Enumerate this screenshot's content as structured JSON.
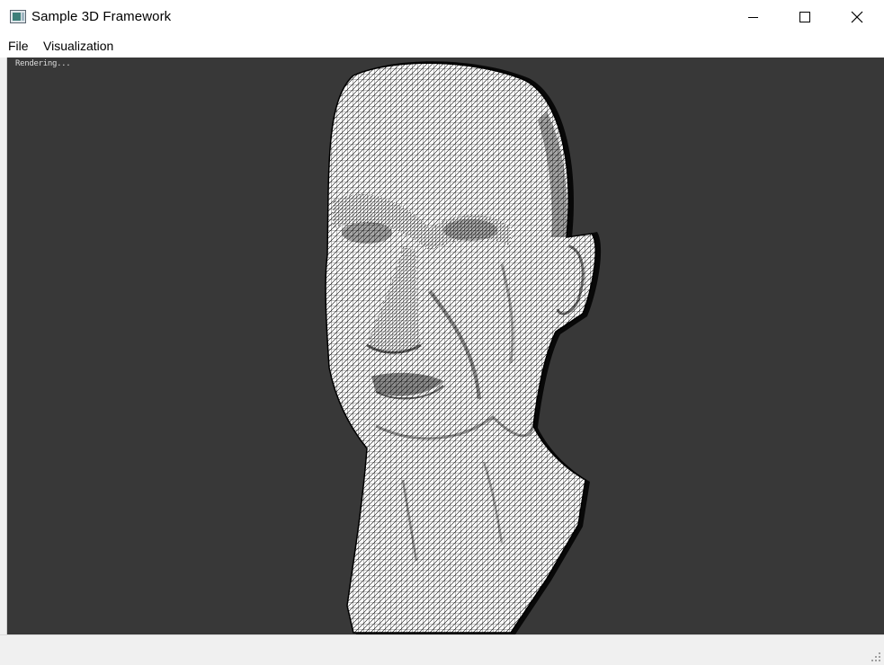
{
  "window": {
    "title": "Sample 3D Framework",
    "icons": {
      "app": "app-window-icon",
      "minimize": "minimize-icon",
      "maximize": "maximize-icon",
      "close": "close-icon",
      "resize": "resize-grip-icon"
    }
  },
  "menu": {
    "items": [
      {
        "label": "File"
      },
      {
        "label": "Visualization"
      }
    ]
  },
  "viewport": {
    "overlay_text": "Rendering...",
    "background_color": "#383838",
    "model": "wireframe head bust",
    "render_mode": "wireframe",
    "mesh_fill_color": "#ffffff",
    "mesh_line_color": "#000000"
  },
  "statusbar": {
    "text": ""
  }
}
